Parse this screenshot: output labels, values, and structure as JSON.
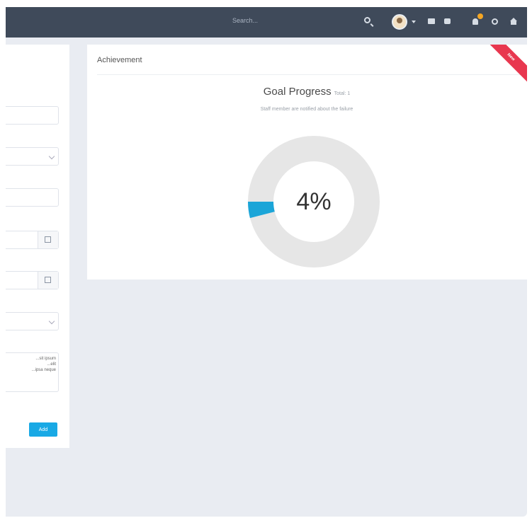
{
  "topbar": {
    "search_placeholder": "Search...",
    "icons": [
      "search-icon",
      "avatar",
      "chevron-down-icon",
      "mail-icon",
      "chat-icon",
      "bell-icon",
      "gear-icon",
      "home-icon"
    ],
    "notification_color": "#f5a623"
  },
  "form": {
    "textarea_value": "...sit ipsum\n...elit\n...ipsa neque",
    "save_label": "Add"
  },
  "card": {
    "title": "Achievement",
    "ribbon": "New",
    "goal_title": "Goal Progress",
    "goal_subtitle": "Total: 1",
    "goal_description": "Staff member are notified about the failure",
    "progress_text": "4%",
    "progress_value": 0.04,
    "accent_color": "#1ba5d8",
    "track_color": "#e6e6e6"
  }
}
